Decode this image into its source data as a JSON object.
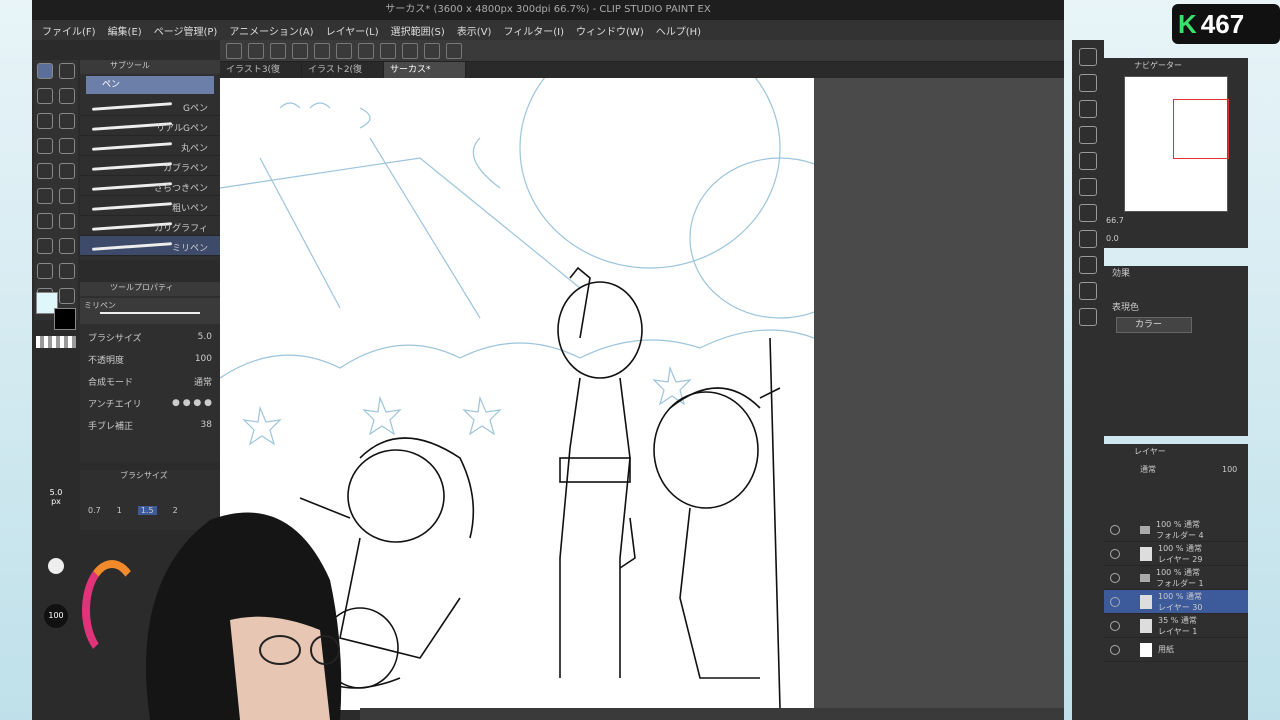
{
  "window": {
    "title": "サーカス* (3600 x 4800px 300dpi 66.7%) - CLIP STUDIO PAINT EX"
  },
  "menu": [
    "ファイル(F)",
    "編集(E)",
    "ページ管理(P)",
    "アニメーション(A)",
    "レイヤー(L)",
    "選択範囲(S)",
    "表示(V)",
    "フィルター(I)",
    "ウィンドウ(W)",
    "ヘルプ(H)"
  ],
  "tabs": [
    "イラスト3(復元)*",
    "イラスト2(復元)*",
    "サーカス*"
  ],
  "subtool": {
    "header": "サブツール",
    "group": "ペン",
    "brushes": [
      "Gペン",
      "リアルGペン",
      "丸ペン",
      "カブラペン",
      "ざらつきペン",
      "粗いペン",
      "カリグラフィ",
      "ミリペン"
    ]
  },
  "toolprop": {
    "header": "ツールプロパティ",
    "preset": "ミリペン",
    "brush_size_label": "ブラシサイズ",
    "brush_size": "5.0",
    "opacity_label": "不透明度",
    "opacity": "100",
    "blend_label": "合成モード",
    "blend": "通常",
    "aa_label": "アンチエイリ",
    "stab_label": "手ブレ補正",
    "stab": "38"
  },
  "brushsize": {
    "header": "ブラシサイズ",
    "values": [
      "0.7",
      "1",
      "1.5",
      "2"
    ],
    "size_readout": "5.0",
    "unit": "px",
    "opacity_readout": "100"
  },
  "navigator": {
    "header": "ナビゲーター",
    "zoom": "66.7",
    "angle": "0.0"
  },
  "effect": {
    "header": "効果",
    "display_color_label": "表現色",
    "display_color": "カラー"
  },
  "layers": {
    "header": "レイヤー",
    "blend": "通常",
    "opacity": "100",
    "items": [
      {
        "mode": "100 % 通常",
        "name": "フォルダー 4"
      },
      {
        "mode": "100 % 通常",
        "name": "レイヤー 29"
      },
      {
        "mode": "100 % 通常",
        "name": "フォルダー 1"
      },
      {
        "mode": "100 % 通常",
        "name": "レイヤー 30"
      },
      {
        "mode": "35 % 通常",
        "name": "レイヤー 1"
      },
      {
        "mode": "",
        "name": "用紙"
      }
    ]
  },
  "overlay": {
    "logo_letter": "K",
    "logo_number": "467"
  }
}
